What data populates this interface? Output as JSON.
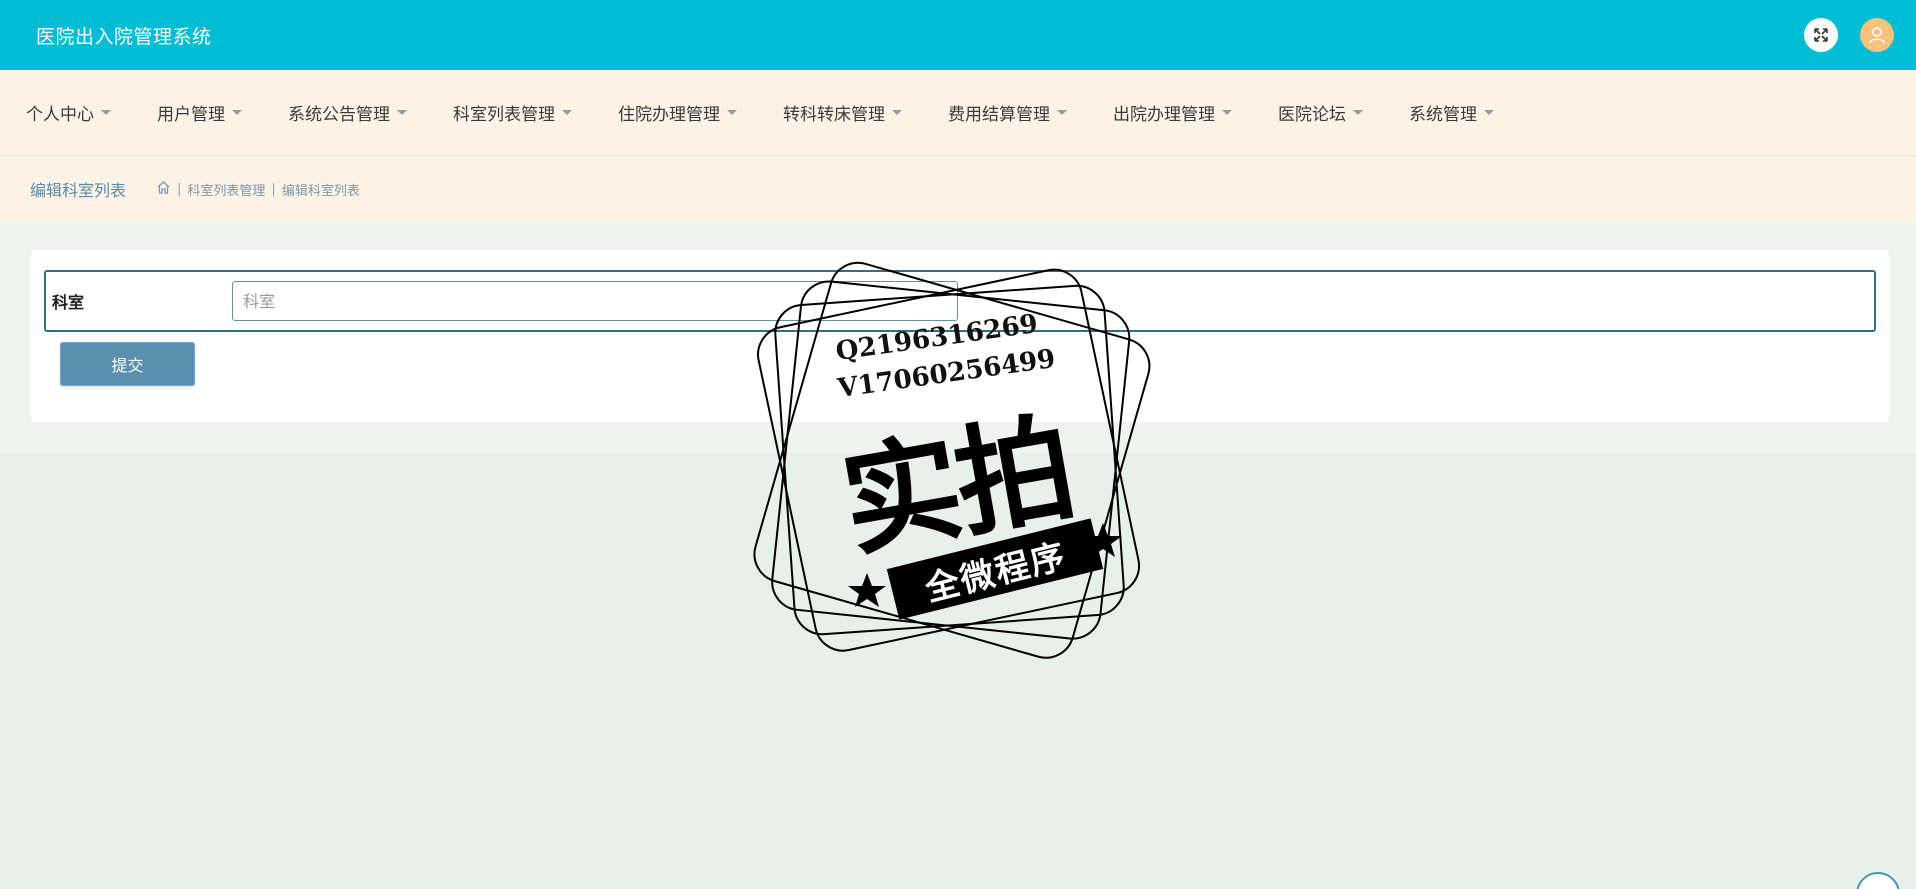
{
  "header": {
    "app_title": "医院出入院管理系统",
    "icons": [
      "expand-icon",
      "user-avatar-icon"
    ],
    "accent_color": "#00bcd4"
  },
  "nav": {
    "items": [
      {
        "label": "个人中心"
      },
      {
        "label": "用户管理"
      },
      {
        "label": "系统公告管理"
      },
      {
        "label": "科室列表管理"
      },
      {
        "label": "住院办理管理"
      },
      {
        "label": "转科转床管理"
      },
      {
        "label": "费用结算管理"
      },
      {
        "label": "出院办理管理"
      },
      {
        "label": "医院论坛"
      },
      {
        "label": "系统管理"
      }
    ]
  },
  "breadcrumb": {
    "page_title": "编辑科室列表",
    "items": [
      "科室列表管理",
      "编辑科室列表"
    ]
  },
  "form": {
    "field_label": "科室",
    "field_placeholder": "科室",
    "field_value": "",
    "submit_label": "提交"
  },
  "watermark": {
    "line1": "Q2196316269",
    "line2": "V17060256499",
    "big": "实拍",
    "ribbon": "全微程序"
  }
}
